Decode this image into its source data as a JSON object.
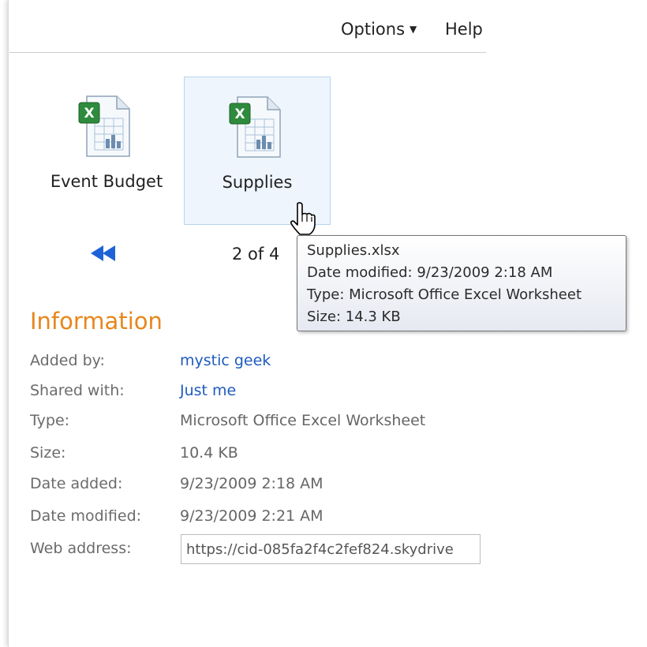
{
  "topbar": {
    "options_label": "Options",
    "help_label": "Help"
  },
  "files": [
    {
      "name": "Event Budget",
      "icon": "excel-file-icon",
      "selected": false
    },
    {
      "name": "Supplies",
      "icon": "excel-file-icon",
      "selected": true
    }
  ],
  "pager": {
    "text": "2 of 4"
  },
  "tooltip": {
    "lines": [
      "Supplies.xlsx",
      "Date modified: 9/23/2009 2:18 AM",
      "Type: Microsoft Office Excel Worksheet",
      "Size: 14.3 KB"
    ]
  },
  "info": {
    "title": "Information",
    "rows": [
      {
        "key": "Added by:",
        "value": "mystic geek"
      },
      {
        "key": "Shared with:",
        "value": "Just me"
      },
      {
        "key": "Type:",
        "value": "Microsoft Office Excel Worksheet"
      },
      {
        "key": "Size:",
        "value": "10.4 KB"
      },
      {
        "key": "Date added:",
        "value": "9/23/2009 2:18 AM"
      },
      {
        "key": "Date modified:",
        "value": "9/23/2009 2:21 AM"
      }
    ],
    "web_address_label": "Web address:",
    "web_address_value": "https://cid-085fa2f4c2fef824.skydrive"
  },
  "colors": {
    "accent_orange": "#e8861b",
    "link_blue": "#1f5bbf",
    "nav_blue": "#1e63d6"
  }
}
